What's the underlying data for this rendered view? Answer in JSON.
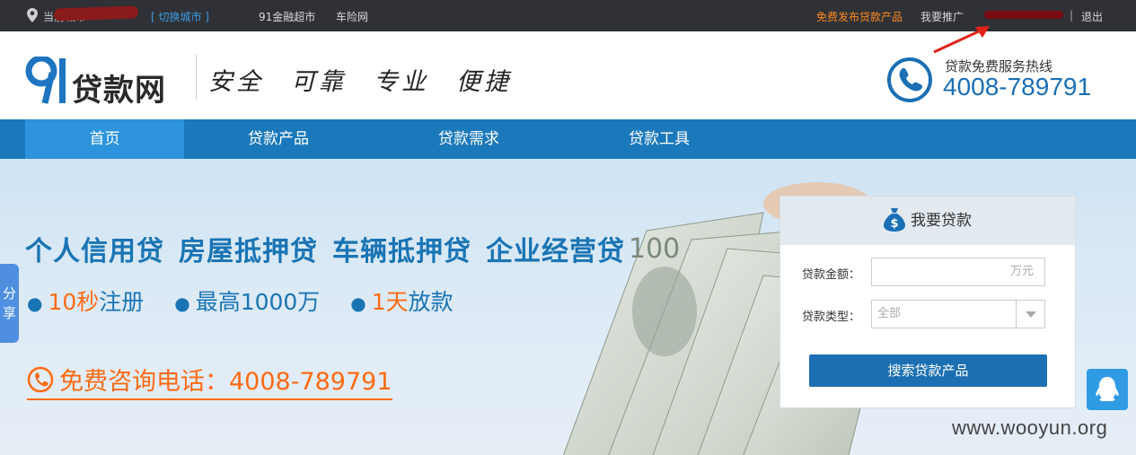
{
  "topbar": {
    "city_prefix": "当前城市",
    "switch_city": "[ 切换城市 ]",
    "links": [
      "91金融超市",
      "车险网"
    ],
    "publish_link": "免费发布贷款产品",
    "promote_link": "我要推广",
    "separator": "|",
    "logout": "退出"
  },
  "header": {
    "logo_mark": "9",
    "logo_text": "贷款网",
    "slogan": [
      "安全",
      "可靠",
      "专业",
      "便捷"
    ],
    "hotline_label": "贷款免费服务热线",
    "hotline_number": "4008-789791"
  },
  "nav": {
    "items": [
      "首页",
      "贷款产品",
      "贷款需求",
      "贷款工具"
    ],
    "active": "首页"
  },
  "banner": {
    "products": [
      "个人信用贷",
      "房屋抵押贷",
      "车辆抵押贷",
      "企业经营贷"
    ],
    "features": [
      {
        "highlight": "10秒",
        "text": "注册"
      },
      {
        "highlight": "",
        "text": "最高1000万"
      },
      {
        "highlight": "1天",
        "text": "放款"
      }
    ],
    "consult": "免费咨询电话：4008-789791"
  },
  "share_tab": "分享",
  "loan_card": {
    "title": "我要贷款",
    "amount_label": "贷款金额：",
    "amount_placeholder": "万元",
    "type_label": "贷款类型：",
    "type_value": "全部",
    "search_button": "搜索贷款产品"
  },
  "watermark": "www.wooyun.org",
  "colors": {
    "topbar_bg": "#2f3137",
    "nav_bg": "#1b78bb",
    "nav_active": "#2d93dc",
    "brand_blue": "#1a74b4",
    "accent_orange": "#ff6a13"
  }
}
